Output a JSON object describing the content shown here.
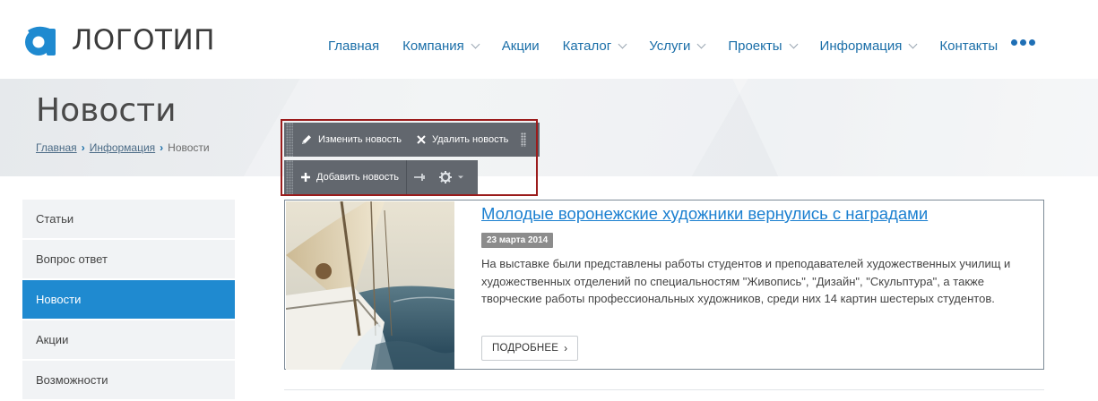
{
  "logo": {
    "text": "ЛОГОТИП",
    "icon": "logo-a-icon",
    "accent": "#1f8ad0"
  },
  "nav": {
    "items": [
      {
        "label": "Главная",
        "dropdown": false
      },
      {
        "label": "Компания",
        "dropdown": true
      },
      {
        "label": "Акции",
        "dropdown": false
      },
      {
        "label": "Каталог",
        "dropdown": true
      },
      {
        "label": "Услуги",
        "dropdown": true
      },
      {
        "label": "Проекты",
        "dropdown": true
      },
      {
        "label": "Информация",
        "dropdown": true
      },
      {
        "label": "Контакты",
        "dropdown": false
      }
    ],
    "more_icon": "more-dots-icon"
  },
  "page": {
    "title": "Новости",
    "breadcrumb": {
      "home": "Главная",
      "section": "Информация",
      "current": "Новости"
    }
  },
  "sidebar": {
    "items": [
      {
        "label": "Статьи",
        "active": false
      },
      {
        "label": "Вопрос ответ",
        "active": false
      },
      {
        "label": "Новости",
        "active": true
      },
      {
        "label": "Акции",
        "active": false
      },
      {
        "label": "Возможности",
        "active": false
      }
    ]
  },
  "admin_toolbar": {
    "edit_label": "Изменить новость",
    "delete_label": "Удалить новость",
    "add_label": "Добавить новость",
    "frame_color": "#9b1b1b"
  },
  "news": {
    "title": "Молодые воронежские художники вернулись с наградами",
    "date": "23 марта 2014",
    "text": "На выставке были представлены работы студентов и преподавателей художественных училищ и художественных отделений по специальностям \"Живопись\", \"Дизайн\", \"Скульптура\", а также творческие работы профессиональных художников, среди них 14 картин шестерых студентов.",
    "more_label": "ПОДРОБНЕЕ",
    "link_color": "#1a7fd0"
  }
}
